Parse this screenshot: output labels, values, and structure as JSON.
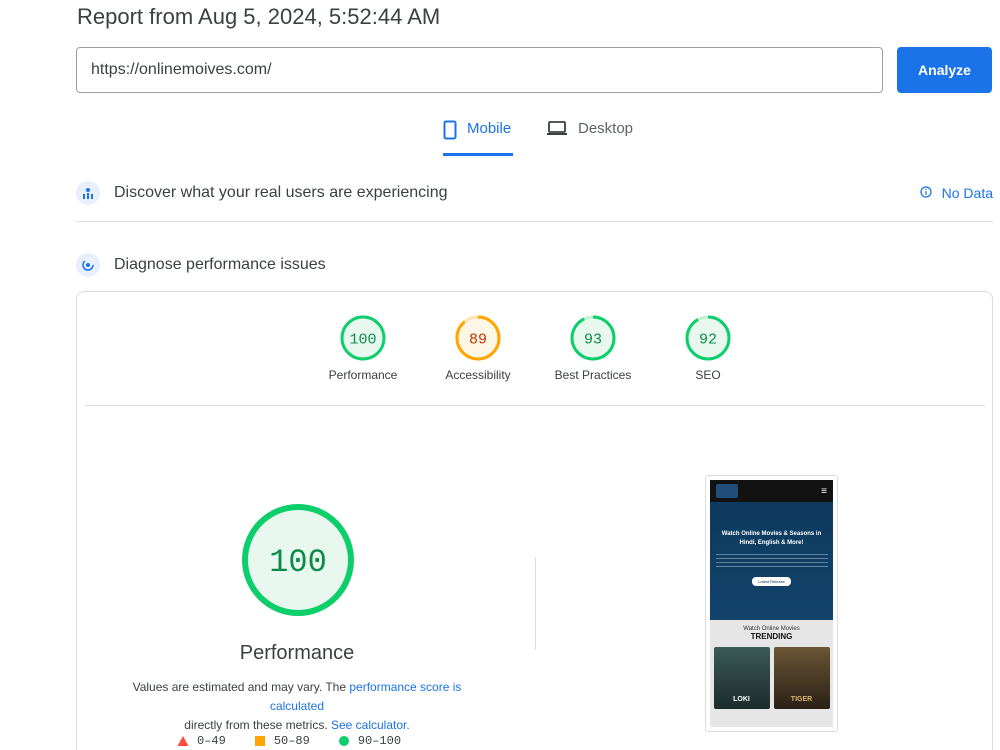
{
  "report": {
    "title": "Report from Aug 5, 2024, 5:52:44 AM"
  },
  "url_bar": {
    "value": "https://onlinemoives.com/",
    "analyze_label": "Analyze"
  },
  "tabs": [
    {
      "label": "Mobile",
      "icon": "smartphone-icon",
      "active": true
    },
    {
      "label": "Desktop",
      "icon": "laptop-icon",
      "active": false
    }
  ],
  "crux": {
    "title": "Discover what your real users are experiencing",
    "status": "No Data",
    "status_icon": "info-icon"
  },
  "diagnose": {
    "title": "Diagnose performance issues"
  },
  "colors": {
    "pass": "#0cce6b",
    "average": "#ffa400",
    "fail": "#ff4e42",
    "accent": "#1a73e8"
  },
  "scores": [
    {
      "label": "Performance",
      "value": "100",
      "rating": "pass"
    },
    {
      "label": "Accessibility",
      "value": "89",
      "rating": "average"
    },
    {
      "label": "Best Practices",
      "value": "93",
      "rating": "pass"
    },
    {
      "label": "SEO",
      "value": "92",
      "rating": "pass"
    }
  ],
  "performance": {
    "score": "100",
    "label": "Performance",
    "note_prefix": "Values are estimated and may vary. The ",
    "note_link1": "performance score is calculated",
    "note_middle": " directly from these metrics. ",
    "note_link2": "See calculator."
  },
  "legend": [
    {
      "range": "0–49",
      "shape": "triangle",
      "color": "#ff4e42"
    },
    {
      "range": "50–89",
      "shape": "square",
      "color": "#ffa400"
    },
    {
      "range": "90–100",
      "shape": "circle",
      "color": "#0cce6b"
    }
  ],
  "screenshot": {
    "hero_title": "Watch Online Movies & Seasons in Hindi, English & More!",
    "hero_button": "Latest Release",
    "trending_sub": "Watch Online Movies",
    "trending_title": "TRENDING",
    "poster_1": "LOKI",
    "poster_2": "TIGER"
  }
}
